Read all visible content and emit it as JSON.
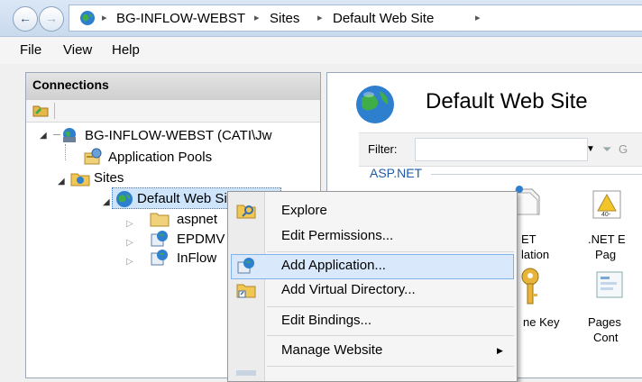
{
  "addressbar": {
    "crumbs": [
      "BG-INFLOW-WEBST",
      "Sites",
      "Default Web Site"
    ],
    "separator": "▸"
  },
  "menubar": {
    "items": [
      "File",
      "View",
      "Help"
    ]
  },
  "connections": {
    "title": "Connections",
    "tree": {
      "server": "BG-INFLOW-WEBST (CATI\\Jw",
      "app_pools": "Application Pools",
      "sites": "Sites",
      "default_site": "Default Web Site",
      "children": [
        "aspnet",
        "EPDMV",
        "InFlow"
      ]
    }
  },
  "main": {
    "title": "Default Web Site",
    "filter_label": "Filter:",
    "filter_go_partial": "G",
    "section": "ASP.NET",
    "features": [
      {
        "line1": "ET",
        "line2": "lation"
      },
      {
        "line1": ".NET E",
        "line2": "Pag"
      },
      {
        "line1": "ne Key",
        "line2": ""
      },
      {
        "line1": "Pages",
        "line2": "Cont"
      }
    ]
  },
  "context_menu": {
    "items": [
      "Explore",
      "Edit Permissions...",
      "Add Application...",
      "Add Virtual Directory...",
      "Edit Bindings...",
      "Manage Website"
    ],
    "highlighted": "Add Application...",
    "submenu_arrow": "▶"
  },
  "colors": {
    "highlight_bg": "#d9e9fb",
    "highlight_border": "#7eb4ea",
    "link_blue": "#1e5aa8"
  }
}
